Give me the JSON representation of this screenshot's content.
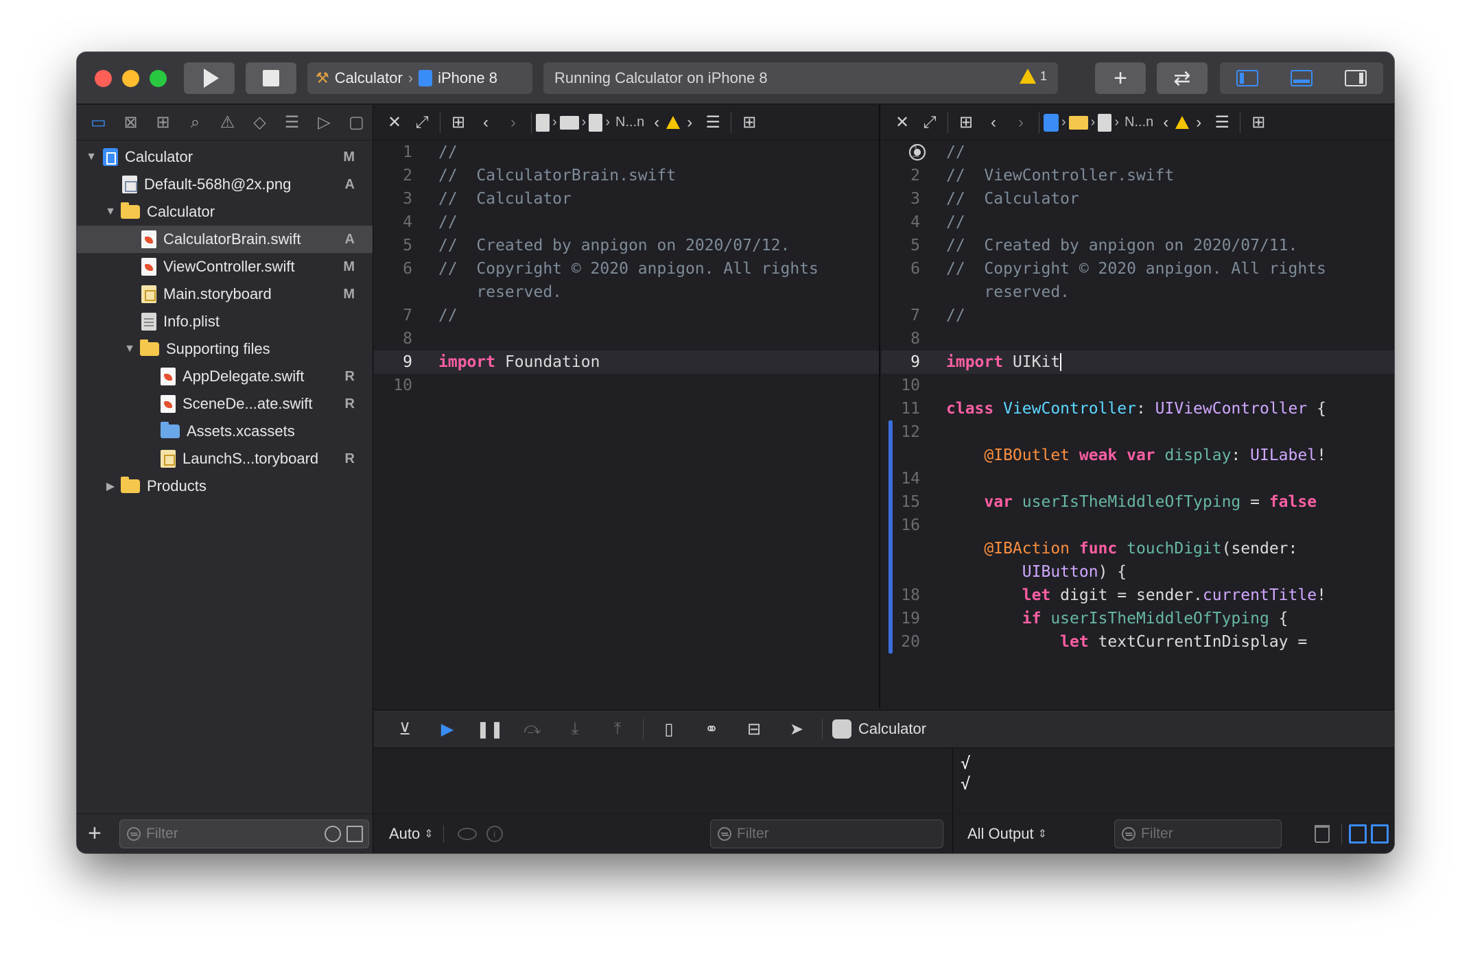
{
  "toolbar": {
    "scheme_app": "Calculator",
    "scheme_device": "iPhone 8",
    "status_text": "Running Calculator on iPhone 8",
    "warning_count": "1",
    "colors": {
      "accent": "#3a8df6",
      "warning": "#f5c400"
    }
  },
  "navigator": {
    "tabs": [
      "folder-icon",
      "source-control-icon",
      "symbol-icon",
      "find-icon",
      "issue-icon",
      "test-icon",
      "debug-icon",
      "breakpoint-icon",
      "report-icon"
    ],
    "items": [
      {
        "label": "Calculator",
        "status": "M"
      },
      {
        "label": "Default-568h@2x.png",
        "status": "A"
      },
      {
        "label": "Calculator",
        "status": ""
      },
      {
        "label": "CalculatorBrain.swift",
        "status": "A"
      },
      {
        "label": "ViewController.swift",
        "status": "M"
      },
      {
        "label": "Main.storyboard",
        "status": "M"
      },
      {
        "label": "Info.plist",
        "status": ""
      },
      {
        "label": "Supporting files",
        "status": ""
      },
      {
        "label": "AppDelegate.swift",
        "status": "R"
      },
      {
        "label": "SceneDe...ate.swift",
        "status": "R"
      },
      {
        "label": "Assets.xcassets",
        "status": ""
      },
      {
        "label": "LaunchS...toryboard",
        "status": "R"
      },
      {
        "label": "Products",
        "status": ""
      }
    ],
    "filter_placeholder": "Filter"
  },
  "editor_left": {
    "jump_label": "N...n",
    "lines": [
      {
        "n": "1",
        "t": "//"
      },
      {
        "n": "2",
        "t": "//  CalculatorBrain.swift"
      },
      {
        "n": "3",
        "t": "//  Calculator"
      },
      {
        "n": "4",
        "t": "//"
      },
      {
        "n": "5",
        "t": "//  Created by anpigon on 2020/07/12."
      },
      {
        "n": "6",
        "t": "//  Copyright © 2020 anpigon. All rights"
      },
      {
        "n": "",
        "t": "    reserved."
      },
      {
        "n": "7",
        "t": "//"
      },
      {
        "n": "8",
        "t": ""
      },
      {
        "n": "9",
        "kw": "import",
        "rest": " Foundation"
      },
      {
        "n": "10",
        "t": ""
      }
    ]
  },
  "editor_right": {
    "jump_label": "N...n",
    "lines": [
      {
        "n": "1",
        "t": "//"
      },
      {
        "n": "2",
        "t": "//  ViewController.swift"
      },
      {
        "n": "3",
        "t": "//  Calculator"
      },
      {
        "n": "4",
        "t": "//"
      },
      {
        "n": "5",
        "t": "//  Created by anpigon on 2020/07/11."
      },
      {
        "n": "6",
        "t": "//  Copyright © 2020 anpigon. All rights"
      },
      {
        "n": "",
        "t": "    reserved."
      },
      {
        "n": "7",
        "t": "//"
      },
      {
        "n": "8",
        "t": ""
      },
      {
        "n": "9",
        "kw": "import",
        "rest": " UIKit"
      },
      {
        "n": "10",
        "t": ""
      },
      {
        "n": "11",
        "kw": "class",
        "name": "ViewController",
        "sep": ": ",
        "super": "UIViewController",
        "end": " {"
      },
      {
        "n": "12",
        "t": ""
      },
      {
        "n": "",
        "attr": "@IBOutlet",
        "kw2": " weak var",
        "prop": " display",
        "sep": ": ",
        "type": "UILabel",
        "end": "!"
      },
      {
        "n": "14",
        "t": ""
      },
      {
        "n": "15",
        "kw": "var",
        "prop": " userIsTheMiddleOfTyping",
        "sep": " = ",
        "kw2": "false"
      },
      {
        "n": "16",
        "t": ""
      },
      {
        "n": "",
        "attr": "@IBAction",
        "kw2": " func",
        "fn": " touchDigit",
        "end": "(sender:"
      },
      {
        "n": "",
        "cont": "UIButton) {"
      },
      {
        "n": "18",
        "kw": "let",
        "rest": " digit = sender.",
        "prop2": "currentTitle",
        "end": "!"
      },
      {
        "n": "19",
        "kw": "if",
        "prop": " userIsTheMiddleOfTyping",
        "end": " {"
      },
      {
        "n": "20",
        "kw": "let",
        "rest": " textCurrentInDisplay ="
      }
    ]
  },
  "debug": {
    "target": "Calculator",
    "var_scope": "Auto",
    "var_filter_placeholder": "Filter",
    "console_output": [
      "√",
      "√"
    ],
    "console_scope": "All Output",
    "console_filter_placeholder": "Filter"
  }
}
